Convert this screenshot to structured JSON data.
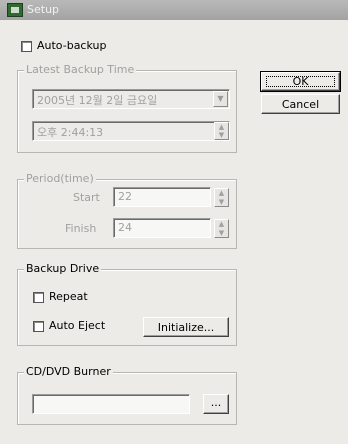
{
  "window": {
    "title": "Setup",
    "icon": "app-window-icon"
  },
  "auto_backup": {
    "label": "Auto-backup",
    "checked": false
  },
  "latest_backup": {
    "legend": "Latest Backup Time",
    "date": "2005년 12월  2일 금요일",
    "time": "오후  2:44:13"
  },
  "period": {
    "legend": "Period(time)",
    "start_label": "Start",
    "start_value": "22",
    "finish_label": "Finish",
    "finish_value": "24"
  },
  "backup_drive": {
    "legend": "Backup Drive",
    "repeat_label": "Repeat",
    "auto_eject_label": "Auto Eject",
    "initialize_label": "Initialize..."
  },
  "burner": {
    "legend": "CD/DVD Burner",
    "value": "",
    "browse_label": "..."
  },
  "buttons": {
    "ok": "OK",
    "cancel": "Cancel"
  },
  "icons": {
    "dropdown": "▼",
    "spin_up": "▲",
    "spin_down": "▼"
  }
}
